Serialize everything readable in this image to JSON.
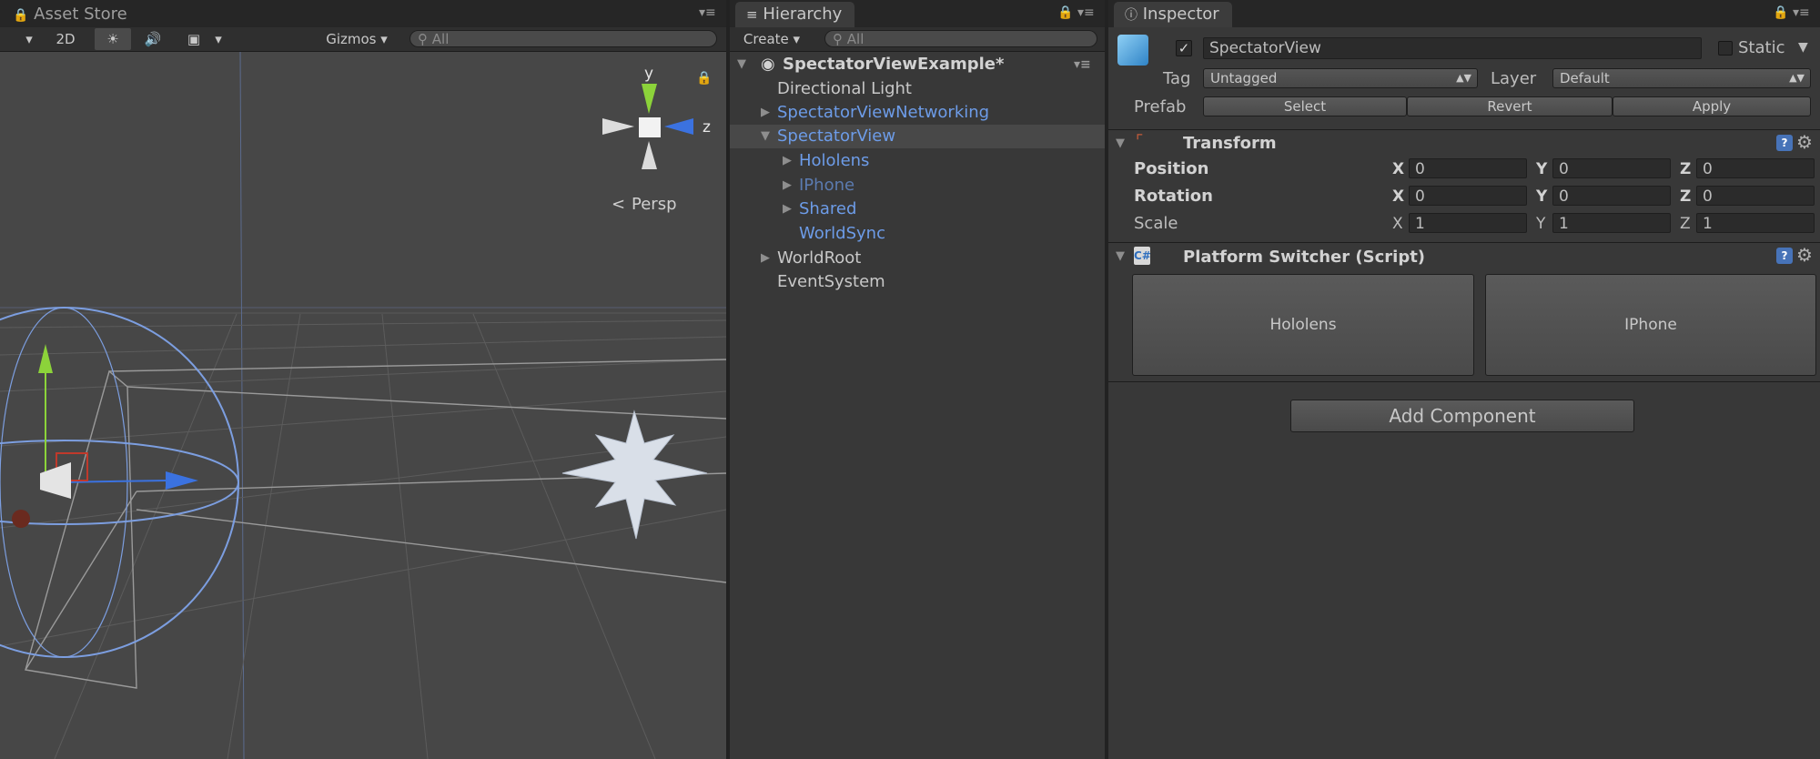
{
  "scene_panel": {
    "tab_title": "Asset Store",
    "toolbar": {
      "mode_2d": "2D",
      "gizmos": "Gizmos",
      "search_placeholder": "All"
    },
    "gizmo": {
      "axis_y": "y",
      "axis_z": "z",
      "projection": "Persp"
    }
  },
  "hierarchy": {
    "tab_title": "Hierarchy",
    "create_label": "Create",
    "search_placeholder": "All",
    "scene_name": "SpectatorViewExample*",
    "items": [
      {
        "label": "Directional Light"
      },
      {
        "label": "SpectatorViewNetworking"
      },
      {
        "label": "SpectatorView"
      },
      {
        "label": "Hololens"
      },
      {
        "label": "IPhone"
      },
      {
        "label": "Shared"
      },
      {
        "label": "WorldSync"
      },
      {
        "label": "WorldRoot"
      },
      {
        "label": "EventSystem"
      }
    ]
  },
  "inspector": {
    "tab_title": "Inspector",
    "object_name": "SpectatorView",
    "static_label": "Static",
    "tag_label": "Tag",
    "tag_value": "Untagged",
    "layer_label": "Layer",
    "layer_value": "Default",
    "prefab_label": "Prefab",
    "prefab_buttons": {
      "select": "Select",
      "revert": "Revert",
      "apply": "Apply"
    },
    "transform": {
      "title": "Transform",
      "rows": [
        {
          "label": "Position",
          "x": "0",
          "y": "0",
          "z": "0"
        },
        {
          "label": "Rotation",
          "x": "0",
          "y": "0",
          "z": "0"
        },
        {
          "label": "Scale",
          "x": "1",
          "y": "1",
          "z": "1"
        }
      ],
      "axis_x": "X",
      "axis_y": "Y",
      "axis_z": "Z"
    },
    "script": {
      "title": "Platform Switcher (Script)",
      "button_hololens": "Hololens",
      "button_iphone": "IPhone"
    },
    "add_component": "Add Component"
  }
}
